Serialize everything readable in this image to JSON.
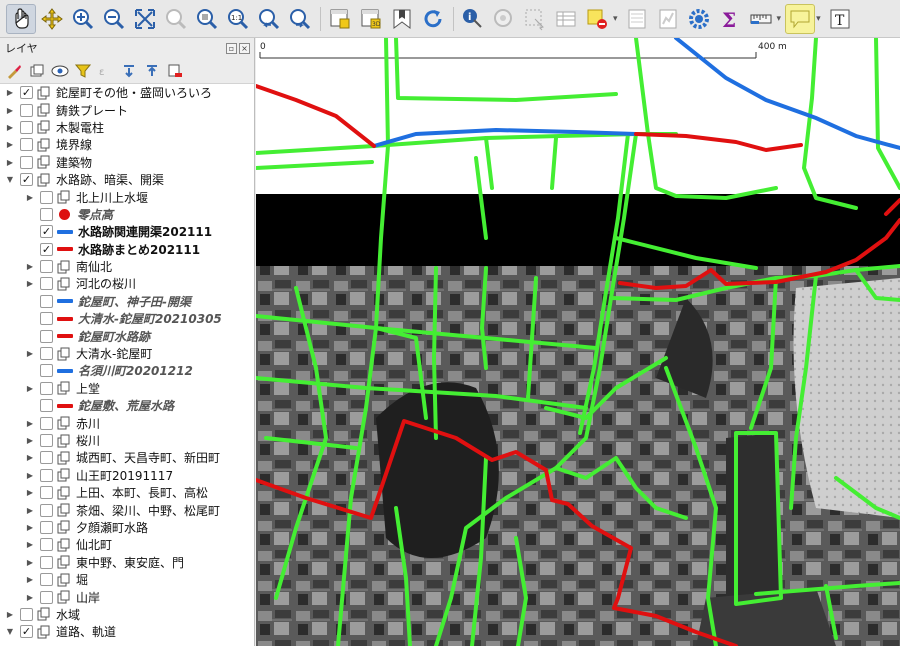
{
  "toolbar": {
    "icons": [
      "pan-hand-icon",
      "pan-to-selection-icon",
      "zoom-in-icon",
      "zoom-out-icon",
      "zoom-full-icon",
      "zoom-to-selection-icon",
      "zoom-to-layer-icon",
      "zoom-native-icon",
      "zoom-last-icon",
      "zoom-next-icon",
      "new-map-view-icon",
      "new-3d-view-icon",
      "bookmarks-icon",
      "refresh-icon",
      "identify-icon",
      "action-icon",
      "select-icon",
      "attribute-table-icon",
      "deselect-icon",
      "field-calculator-icon",
      "statistics-icon",
      "settings-gear-icon",
      "sum-icon",
      "measure-icon",
      "map-tips-icon",
      "text-annotation-icon"
    ]
  },
  "layers_panel": {
    "title": "レイヤ",
    "items": [
      {
        "label": "鉈屋町その他・盛岡いろいろ",
        "checked": true,
        "expand": "collapsed",
        "indent": 0,
        "symbol": "group"
      },
      {
        "label": "鋳鉄プレート",
        "checked": false,
        "expand": "collapsed",
        "indent": 0,
        "symbol": "group"
      },
      {
        "label": "木製電柱",
        "checked": false,
        "expand": "collapsed",
        "indent": 0,
        "symbol": "group"
      },
      {
        "label": "境界線",
        "checked": false,
        "expand": "collapsed",
        "indent": 0,
        "symbol": "group"
      },
      {
        "label": "建築物",
        "checked": false,
        "expand": "collapsed",
        "indent": 0,
        "symbol": "group"
      },
      {
        "label": "水路跡、暗渠、開渠",
        "checked": true,
        "expand": "expanded",
        "indent": 0,
        "symbol": "group"
      },
      {
        "label": "北上川上水堰",
        "checked": false,
        "expand": "collapsed",
        "indent": 1,
        "symbol": "group"
      },
      {
        "label": "零点高",
        "checked": false,
        "expand": "none",
        "indent": 1,
        "symbol": "dot",
        "style": "italic"
      },
      {
        "label": "水路跡関連開渠202111",
        "checked": true,
        "expand": "none",
        "indent": 1,
        "symbol": "line",
        "color": "#1f6fe0",
        "style": "bold"
      },
      {
        "label": "水路跡まとめ202111",
        "checked": true,
        "expand": "none",
        "indent": 1,
        "symbol": "line",
        "color": "#e01010",
        "style": "bold"
      },
      {
        "label": "南仙北",
        "checked": false,
        "expand": "collapsed",
        "indent": 1,
        "symbol": "group"
      },
      {
        "label": "河北の桜川",
        "checked": false,
        "expand": "collapsed",
        "indent": 1,
        "symbol": "group"
      },
      {
        "label": "鉈屋町、神子田-開渠",
        "checked": false,
        "expand": "none",
        "indent": 1,
        "symbol": "line",
        "color": "#1f6fe0",
        "style": "italic"
      },
      {
        "label": "大清水-鉈屋町20210305",
        "checked": false,
        "expand": "none",
        "indent": 1,
        "symbol": "line",
        "color": "#e01010",
        "style": "italic"
      },
      {
        "label": "鉈屋町水路跡",
        "checked": false,
        "expand": "none",
        "indent": 1,
        "symbol": "line",
        "color": "#e01010",
        "style": "italic"
      },
      {
        "label": "大清水-鉈屋町",
        "checked": false,
        "expand": "collapsed",
        "indent": 1,
        "symbol": "group"
      },
      {
        "label": "名須川町20201212",
        "checked": false,
        "expand": "none",
        "indent": 1,
        "symbol": "line",
        "color": "#1f6fe0",
        "style": "italic"
      },
      {
        "label": "上堂",
        "checked": false,
        "expand": "collapsed",
        "indent": 1,
        "symbol": "group"
      },
      {
        "label": "鉈屋敷、荒屋水路",
        "checked": false,
        "expand": "none",
        "indent": 1,
        "symbol": "line",
        "color": "#e01010",
        "style": "italic"
      },
      {
        "label": "赤川",
        "checked": false,
        "expand": "collapsed",
        "indent": 1,
        "symbol": "group"
      },
      {
        "label": "桜川",
        "checked": false,
        "expand": "collapsed",
        "indent": 1,
        "symbol": "group"
      },
      {
        "label": "城西町、天昌寺町、新田町",
        "checked": false,
        "expand": "collapsed",
        "indent": 1,
        "symbol": "group"
      },
      {
        "label": "山王町20191117",
        "checked": false,
        "expand": "collapsed",
        "indent": 1,
        "symbol": "group"
      },
      {
        "label": "上田、本町、長町、高松",
        "checked": false,
        "expand": "collapsed",
        "indent": 1,
        "symbol": "group"
      },
      {
        "label": "茶畑、梁川、中野、松尾町",
        "checked": false,
        "expand": "collapsed",
        "indent": 1,
        "symbol": "group"
      },
      {
        "label": "夕顔瀬町水路",
        "checked": false,
        "expand": "collapsed",
        "indent": 1,
        "symbol": "group"
      },
      {
        "label": "仙北町",
        "checked": false,
        "expand": "collapsed",
        "indent": 1,
        "symbol": "group"
      },
      {
        "label": "東中野、東安庭、門",
        "checked": false,
        "expand": "collapsed",
        "indent": 1,
        "symbol": "group"
      },
      {
        "label": "堀",
        "checked": false,
        "expand": "collapsed",
        "indent": 1,
        "symbol": "group"
      },
      {
        "label": "山岸",
        "checked": false,
        "expand": "collapsed",
        "indent": 1,
        "symbol": "group"
      },
      {
        "label": "水域",
        "checked": false,
        "expand": "collapsed",
        "indent": 0,
        "symbol": "group"
      },
      {
        "label": "道路、軌道",
        "checked": true,
        "expand": "expanded",
        "indent": 0,
        "symbol": "group"
      }
    ]
  },
  "map": {
    "scale_start": "0",
    "scale_end": "400 m",
    "colors": {
      "route": "#44ee33",
      "channel": "#1f6fe0",
      "trace": "#e01010",
      "band": "#000000"
    }
  }
}
